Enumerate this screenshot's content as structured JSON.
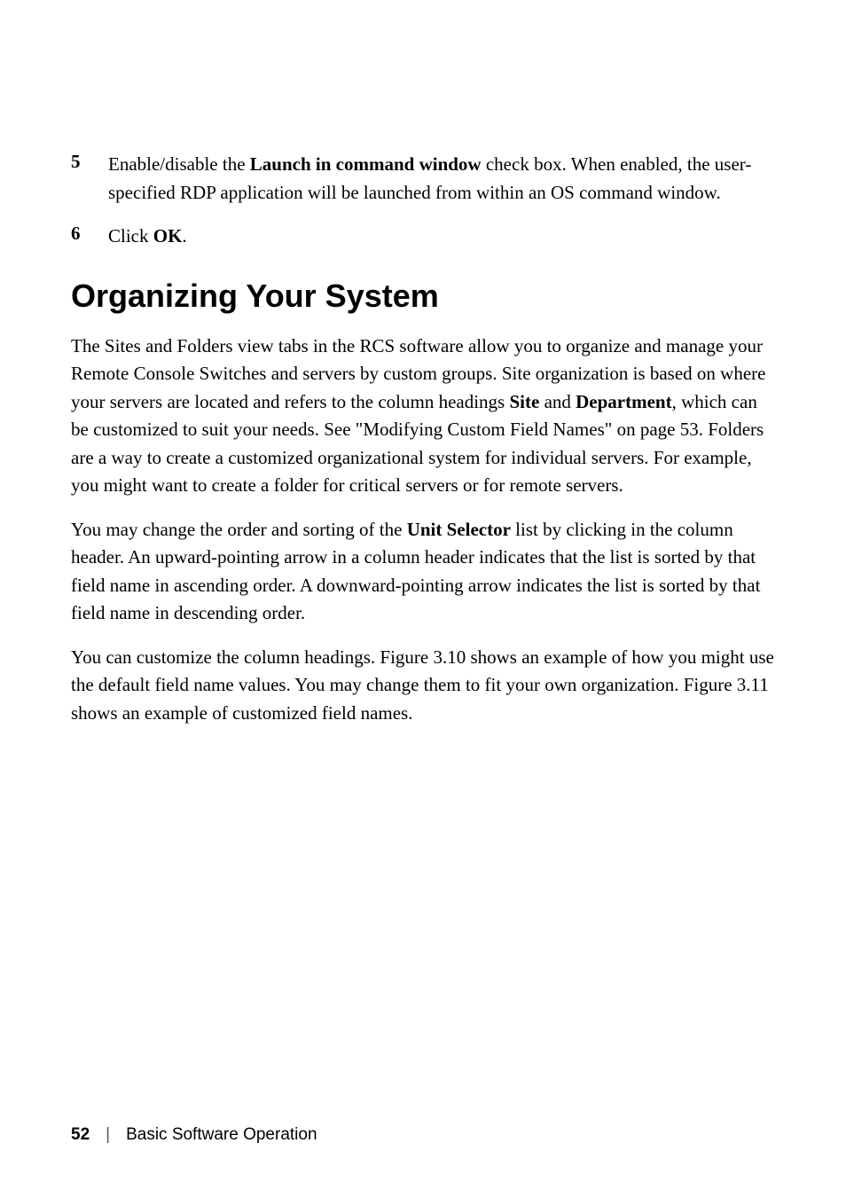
{
  "list": {
    "item5": {
      "number": "5",
      "text_before_bold": "Enable/disable the ",
      "bold": "Launch in command window",
      "text_after_bold": " check box. When enabled, the user-specified RDP application will be launched from within an OS command window."
    },
    "item6": {
      "number": "6",
      "text_before_bold": "Click ",
      "bold": "OK",
      "text_after_bold": "."
    }
  },
  "heading": "Organizing Your System",
  "paragraphs": {
    "p1": {
      "part1": "The Sites and Folders view tabs in the RCS software allow you to organize and manage your Remote Console Switches and servers by custom groups. Site organization is based on where your servers are located and refers to the column headings ",
      "bold1": "Site",
      "part2": " and ",
      "bold2": "Department",
      "part3": ", which can be customized to suit your needs. See \"Modifying Custom Field Names\" on page 53. Folders are a way to create a customized organizational system for individual servers. For example, you might want to create a folder for critical servers or for remote servers."
    },
    "p2": {
      "part1": "You may change the order and sorting of the ",
      "bold1": "Unit Selector",
      "part2": " list by clicking in the column header. An upward-pointing arrow in a column header indicates that the list is sorted by that field name in ascending order. A downward-pointing arrow indicates the list is sorted by that field name in descending order."
    },
    "p3": "You can customize the column headings. Figure 3.10 shows an example of how you might use the default field name values. You may change them to fit your own organization. Figure 3.11 shows an example of customized field names."
  },
  "footer": {
    "page_number": "52",
    "section": "Basic Software Operation"
  }
}
